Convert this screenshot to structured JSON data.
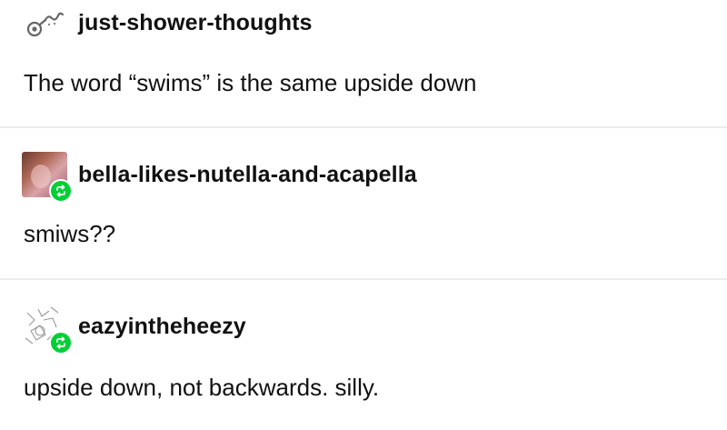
{
  "posts": [
    {
      "username": "just-shower-thoughts",
      "text": "The word “swims” is the same upside down",
      "avatar_icon": "shower-head-icon",
      "reblog": false
    },
    {
      "username": "bella-likes-nutella-and-acapella",
      "text": "smiws??",
      "avatar_icon": "photo-avatar",
      "reblog": true
    },
    {
      "username": "eazyintheheezy",
      "text": "upside down, not backwards. silly.",
      "avatar_icon": "line-art-avatar",
      "reblog": true
    }
  ],
  "colors": {
    "reblog_badge": "#00cf35",
    "divider": "#ececec",
    "text": "#111111"
  }
}
